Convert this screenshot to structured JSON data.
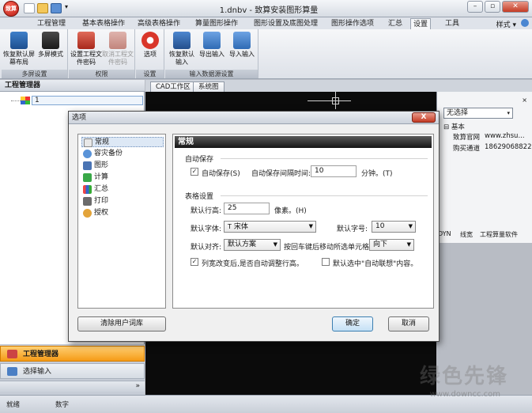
{
  "window": {
    "title": "1.dnbv - 致算安装图形算量",
    "orb_text": "致算"
  },
  "ribbon_tabs": [
    "工程管理",
    "基本表格操作",
    "高级表格操作",
    "算量图形操作",
    "图形设置及底图处理",
    "图形操作选项",
    "汇总",
    "设置",
    "工具"
  ],
  "ribbon_active_tab": "设置",
  "style_label": "样式 ▾",
  "ribbon_groups": [
    {
      "label": "多屏设置",
      "buttons": [
        "恢复默认屏幕布局",
        "多屏模式"
      ]
    },
    {
      "label": "权限",
      "buttons": [
        "设置工程文件密码",
        "取消工程文件密码"
      ]
    },
    {
      "label": "设置",
      "buttons": [
        "选项"
      ]
    },
    {
      "label": "输入数据源设置",
      "buttons": [
        "恢复默认输入",
        "导出输入",
        "导入输入"
      ]
    }
  ],
  "left_panel": {
    "title": "工程管理器",
    "tree_item": "1",
    "nav": {
      "project_manager": "工程管理器",
      "select_input": "选择输入",
      "expand": "»"
    }
  },
  "work_tabs": [
    "CAD工作区",
    "系统图"
  ],
  "prop_panel": {
    "select_value": "无选择",
    "section": "基本",
    "rows": [
      [
        "致算官网",
        "www.zhsu..."
      ],
      [
        "购买通道",
        "18629068822"
      ]
    ],
    "bottom_tabs": [
      "DYN",
      "线宽",
      "工程算量软件"
    ]
  },
  "statusbar": {
    "ready": "就绪",
    "numlock": "数字"
  },
  "dialog": {
    "title": "选项",
    "close": "X",
    "nav_items": [
      "常规",
      "容灾备份",
      "图形",
      "计算",
      "汇总",
      "打印",
      "授权"
    ],
    "content_title": "常规",
    "autosave": {
      "section": "自动保存",
      "checkbox_label": "自动保存(S)",
      "interval_label": "自动保存间隔时间:",
      "interval_value": "10",
      "unit": "分钟。(T)"
    },
    "table": {
      "section": "表格设置",
      "row_height_label": "默认行高:",
      "row_height_value": "25",
      "row_height_unit": "像素。(H)",
      "font_label": "默认字体:",
      "font_value": "宋体",
      "fontsize_label": "默认字号:",
      "fontsize_value": "10",
      "align_label": "默认对齐:",
      "align_value": "默认方案",
      "enter_move_label": "按回车键后移动所选单元格:",
      "enter_move_value": "向下",
      "auto_row_height": "列宽改变后,是否自动调整行高。",
      "auto_association": "默认选中\"自动联想\"内容。"
    },
    "clear_lexicon": "清除用户词库",
    "ok": "确定",
    "cancel": "取消"
  },
  "watermark": {
    "text": "绿色先锋",
    "url": "www.downcc.com"
  }
}
